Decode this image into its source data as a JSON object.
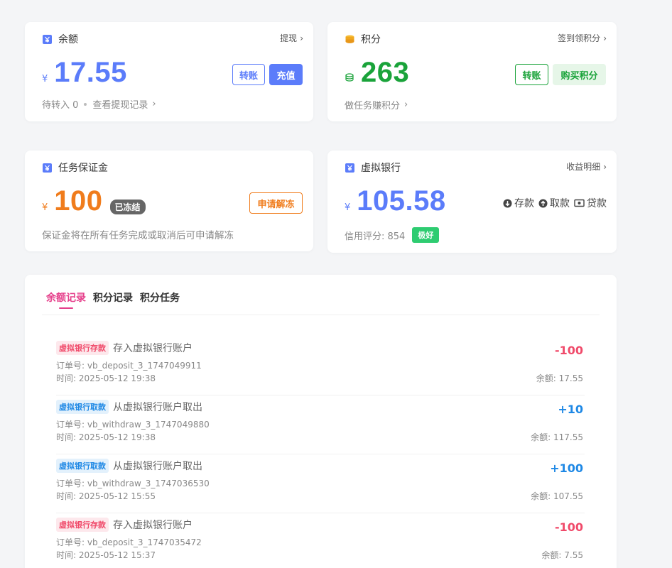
{
  "balance": {
    "title": "余额",
    "link": "提现",
    "currency": "¥",
    "amount": "17.55",
    "transfer_label": "转账",
    "recharge_label": "充值",
    "pending": "待转入 0",
    "records_link": "查看提现记录",
    "icon": "wallet-icon"
  },
  "points": {
    "title": "积分",
    "link": "签到领积分",
    "amount": "263",
    "transfer_label": "转账",
    "buy_label": "购买积分",
    "tasks_link": "做任务赚积分",
    "icon": "coins-icon"
  },
  "deposit": {
    "title": "任务保证金",
    "currency": "¥",
    "amount": "100",
    "frozen_badge": "已冻结",
    "unfreeze_label": "申请解冻",
    "note": "保证金将在所有任务完成或取消后可申请解冻",
    "icon": "wallet-icon"
  },
  "bank": {
    "title": "虚拟银行",
    "link": "收益明细",
    "currency": "¥",
    "amount": "105.58",
    "deposit_label": "存款",
    "withdraw_label": "取款",
    "loan_label": "贷款",
    "credit": "信用评分: 854",
    "credit_badge": "极好",
    "icon": "wallet-icon"
  },
  "tabs": [
    "余额记录",
    "积分记录",
    "积分任务"
  ],
  "records": [
    {
      "tag": "虚拟银行存款",
      "type": "deposit",
      "desc": "存入虚拟银行账户",
      "order": "订单号: vb_deposit_3_1747049911",
      "time": "时间: 2025-05-12 19:38",
      "amount": "-100",
      "balance": "余额: 17.55"
    },
    {
      "tag": "虚拟银行取款",
      "type": "withdraw",
      "desc": "从虚拟银行账户取出",
      "order": "订单号: vb_withdraw_3_1747049880",
      "time": "时间: 2025-05-12 19:38",
      "amount": "+10",
      "balance": "余额: 117.55"
    },
    {
      "tag": "虚拟银行取款",
      "type": "withdraw",
      "desc": "从虚拟银行账户取出",
      "order": "订单号: vb_withdraw_3_1747036530",
      "time": "时间: 2025-05-12 15:55",
      "amount": "+100",
      "balance": "余额: 107.55"
    },
    {
      "tag": "虚拟银行存款",
      "type": "deposit",
      "desc": "存入虚拟银行账户",
      "order": "订单号: vb_deposit_3_1747035472",
      "time": "时间: 2025-05-12 15:37",
      "amount": "-100",
      "balance": "余额: 7.55"
    }
  ],
  "colors": {
    "primary_blue": "#5b7cfa",
    "green": "#1aa33a",
    "orange": "#f07c1c",
    "red": "#f04a6a",
    "plus_blue": "#1e88e5",
    "pink_tab": "#e53e8a",
    "badge_green": "#2ecc71"
  }
}
